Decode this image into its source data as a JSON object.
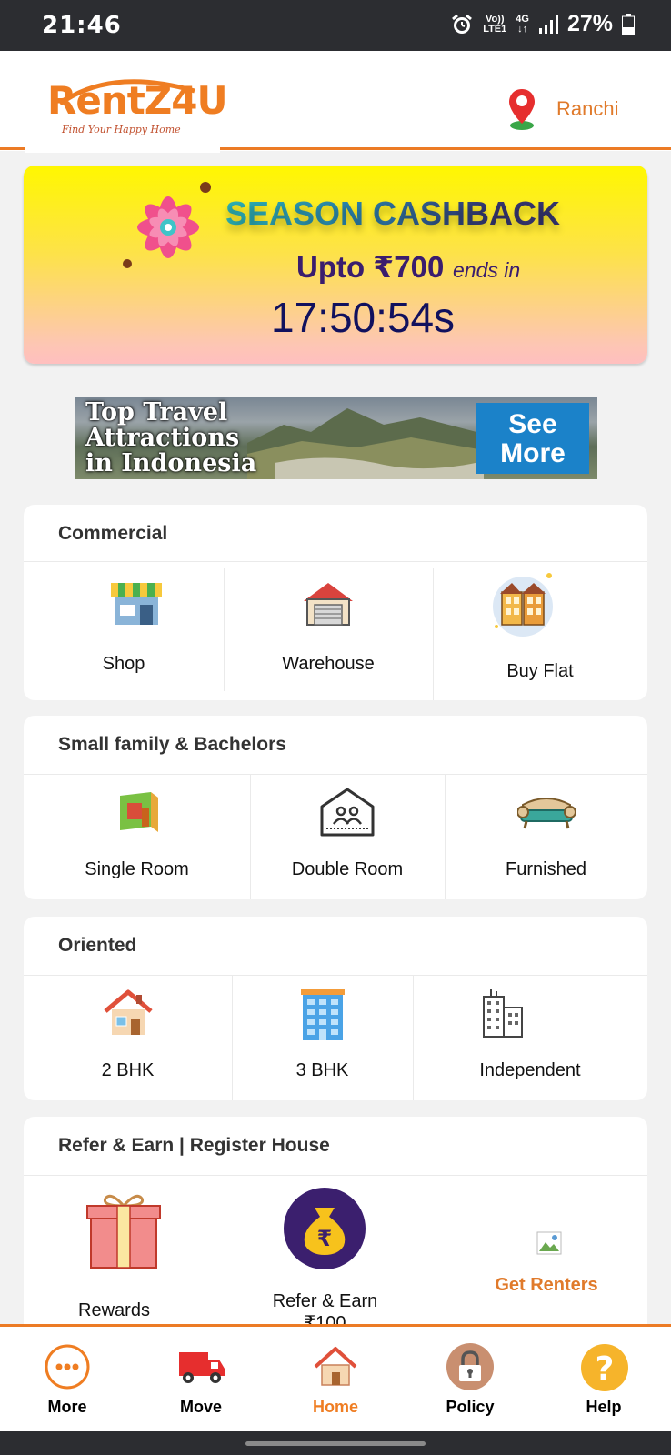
{
  "status_bar": {
    "time": "21:46",
    "network_top": "Vo))",
    "network_bottom": "LTE1",
    "network_type": "4G",
    "battery_percent": "27%"
  },
  "header": {
    "logo_text": "RentZ4U",
    "logo_tagline": "Find Your Happy Home",
    "location": "Ranchi"
  },
  "promo": {
    "headline": "SEASON CASHBACK",
    "offer": "Upto ₹700",
    "ends": "ends in",
    "timer": "17:50:54s"
  },
  "ad": {
    "line1": "Top Travel",
    "line2": "Attractions",
    "line3": "in Indonesia",
    "cta_line1": "See",
    "cta_line2": "More"
  },
  "sections": {
    "commercial": {
      "title": "Commercial",
      "items": [
        "Shop",
        "Warehouse",
        "Buy Flat"
      ]
    },
    "small_family": {
      "title": "Small family & Bachelors",
      "items": [
        "Single Room",
        "Double Room",
        "Furnished"
      ]
    },
    "oriented": {
      "title": "Oriented",
      "items": [
        "2 BHK",
        "3 BHK",
        "Independent"
      ]
    },
    "refer": {
      "title": "Refer & Earn | Register House",
      "items": [
        "Rewards",
        "Refer & Earn",
        "₹100",
        "Get Renters"
      ]
    }
  },
  "bottom_nav": {
    "items": [
      "More",
      "Move",
      "Home",
      "Policy",
      "Help"
    ],
    "active": "Home"
  },
  "colors": {
    "brand_orange": "#ef7d22",
    "dark_purple": "#3a1d6e",
    "timer_navy": "#11115e"
  }
}
